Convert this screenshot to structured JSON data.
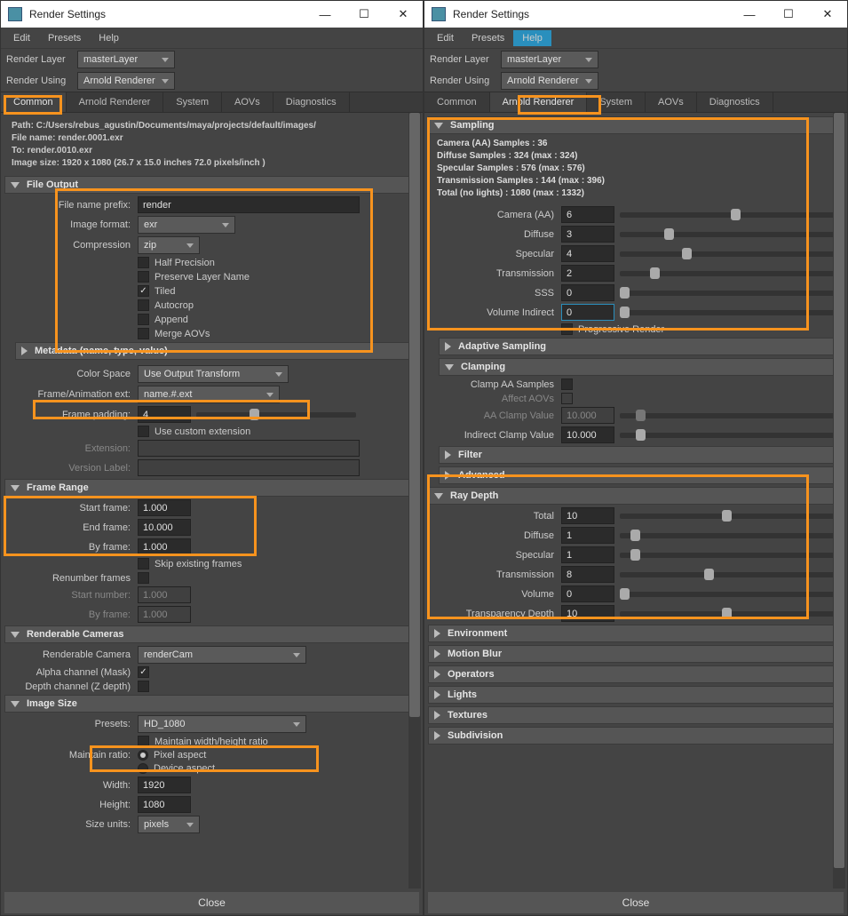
{
  "title": "Render Settings",
  "wbtns": {
    "min": "—",
    "max": "☐",
    "close": "✕"
  },
  "menus1": [
    "Edit",
    "Presets",
    "Help"
  ],
  "menus2": [
    "Edit",
    "Presets",
    "Help"
  ],
  "renderLayerLbl": "Render Layer",
  "renderLayerVal": "masterLayer",
  "renderUsingLbl": "Render Using",
  "renderUsingVal": "Arnold Renderer",
  "tabs": [
    "Common",
    "Arnold Renderer",
    "System",
    "AOVs",
    "Diagnostics"
  ],
  "path": {
    "l1": "Path: C:/Users/rebus_agustin/Documents/maya/projects/default/images/",
    "l2": "File name:  render.0001.exr",
    "l3": "To:            render.0010.exr",
    "l4": "Image size: 1920 x 1080 (26.7 x 15.0 inches 72.0 pixels/inch )"
  },
  "fileOutput": {
    "hdr": "File Output",
    "prefixLbl": "File name prefix:",
    "prefixVal": "render",
    "formatLbl": "Image format:",
    "formatVal": "exr",
    "compLbl": "Compression",
    "compVal": "zip",
    "halfPrecision": "Half Precision",
    "preserveLayer": "Preserve Layer Name",
    "tiled": "Tiled",
    "autocrop": "Autocrop",
    "append": "Append",
    "mergeAOVs": "Merge AOVs"
  },
  "metadata": "Metadata (name, type, value)",
  "colorSpaceLbl": "Color Space",
  "colorSpaceVal": "Use Output Transform",
  "frameExtLbl": "Frame/Animation ext:",
  "frameExtVal": "name.#.ext",
  "framePaddingLbl": "Frame padding:",
  "framePaddingVal": "4",
  "useCustomExt": "Use custom extension",
  "extensionLbl": "Extension:",
  "versionLbl": "Version Label:",
  "frameRange": {
    "hdr": "Frame Range",
    "startLbl": "Start frame:",
    "startVal": "1.000",
    "endLbl": "End frame:",
    "endVal": "10.000",
    "byLbl": "By frame:",
    "byVal": "1.000",
    "skip": "Skip existing frames",
    "renumber": "Renumber frames",
    "startNumLbl": "Start number:",
    "startNumVal": "1.000",
    "byFrame2Lbl": "By frame:",
    "byFrame2Val": "1.000"
  },
  "renderCam": {
    "hdr": "Renderable Cameras",
    "lbl": "Renderable Camera",
    "val": "renderCam",
    "alpha": "Alpha channel (Mask)",
    "depth": "Depth channel (Z depth)"
  },
  "imageSize": {
    "hdr": "Image Size",
    "presetsLbl": "Presets:",
    "presetsVal": "HD_1080",
    "maintainRatio": "Maintain width/height ratio",
    "maintainLbl": "Maintain ratio:",
    "pixelAspect": "Pixel aspect",
    "deviceAspect": "Device aspect",
    "widthLbl": "Width:",
    "widthVal": "1920",
    "heightLbl": "Height:",
    "heightVal": "1080",
    "sizeUnitsLbl": "Size units:",
    "sizeUnitsVal": "pixels"
  },
  "close": "Close",
  "sampling": {
    "hdr": "Sampling",
    "info1": "Camera (AA) Samples : 36",
    "info2": "Diffuse Samples : 324 (max : 324)",
    "info3": "Specular Samples : 576 (max : 576)",
    "info4": "Transmission Samples : 144 (max : 396)",
    "info5": "Total (no lights) : 1080 (max : 1332)",
    "cameraLbl": "Camera (AA)",
    "cameraVal": "6",
    "diffuseLbl": "Diffuse",
    "diffuseVal": "3",
    "specularLbl": "Specular",
    "specularVal": "4",
    "transLbl": "Transmission",
    "transVal": "2",
    "sssLbl": "SSS",
    "sssVal": "0",
    "volLbl": "Volume Indirect",
    "volVal": "0",
    "progressive": "Progressive Render"
  },
  "adaptive": "Adaptive Sampling",
  "clamping": {
    "hdr": "Clamping",
    "clampAA": "Clamp AA Samples",
    "affect": "Affect AOVs",
    "aaClampLbl": "AA Clamp Value",
    "aaClampVal": "10.000",
    "indirectLbl": "Indirect Clamp Value",
    "indirectVal": "10.000"
  },
  "filter": "Filter",
  "advanced": "Advanced",
  "rayDepth": {
    "hdr": "Ray Depth",
    "totalLbl": "Total",
    "totalVal": "10",
    "diffuseLbl": "Diffuse",
    "diffuseVal": "1",
    "specularLbl": "Specular",
    "specularVal": "1",
    "transLbl": "Transmission",
    "transVal": "8",
    "volLbl": "Volume",
    "volVal": "0",
    "transpLbl": "Transparency Depth",
    "transpVal": "10"
  },
  "sections2": [
    "Environment",
    "Motion Blur",
    "Operators",
    "Lights",
    "Textures",
    "Subdivision"
  ]
}
